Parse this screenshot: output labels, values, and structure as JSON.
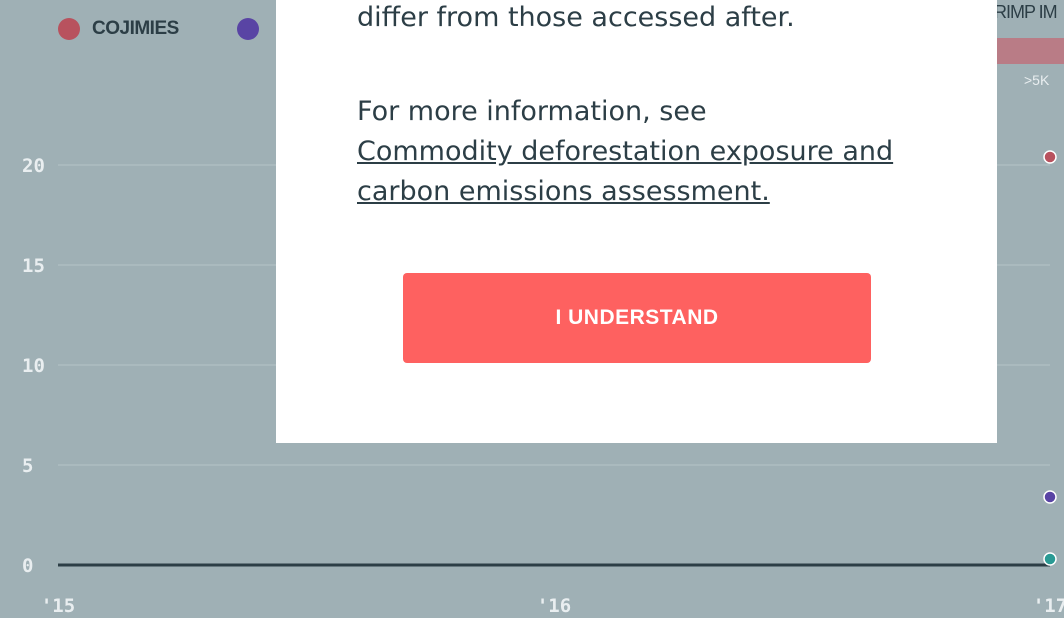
{
  "legend": [
    {
      "label": "COJIMIES",
      "color": "#b8525e"
    },
    {
      "label": "",
      "color": "#5944a4"
    }
  ],
  "top_right": {
    "label": "RIMP IM",
    "range": ">5K"
  },
  "modal": {
    "paragraph1": "Numbers accessed before that date will differ from those accessed after.",
    "paragraph2_prefix": "For more information, see",
    "link": "Commodity deforestation exposure and carbon emissions assessment.",
    "button": "I UNDERSTAND"
  },
  "chart_data": {
    "type": "line",
    "x_ticks": [
      "'15",
      "'16",
      "'17"
    ],
    "y_ticks": [
      0,
      5,
      10,
      15,
      20
    ],
    "ylim": [
      0,
      20
    ],
    "grid": true,
    "series_points": [
      {
        "color": "#b8525e",
        "x": "'17",
        "y": 20.4
      },
      {
        "color": "#5944a4",
        "x": "'17",
        "y": 3.4
      },
      {
        "color": "#2a9a94",
        "x": "'17",
        "y": 0.3
      }
    ],
    "baseline_color": "#2c3e46"
  }
}
